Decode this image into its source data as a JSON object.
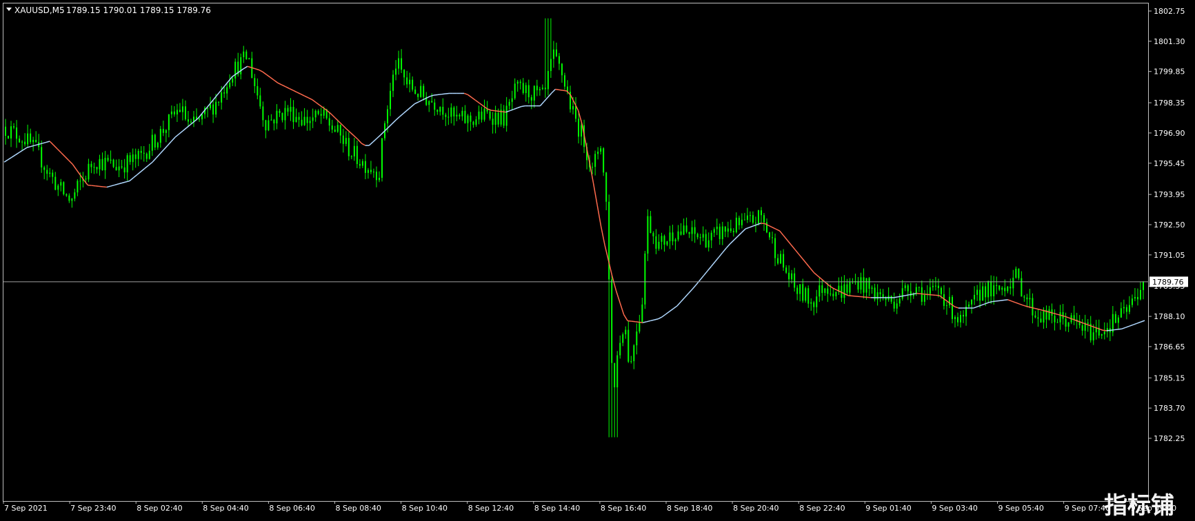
{
  "header": {
    "symbol_label": "XAUUSD,M5",
    "ohlc_label": "1789.15 1790.01 1789.15 1789.76"
  },
  "watermark": {
    "text": "指标铺"
  },
  "colors": {
    "background": "#000000",
    "frame": "#c0c0c0",
    "candle": "#00ff00",
    "ma_rising": "#b0d8ff",
    "ma_falling": "#ff6a4d",
    "price_line": "#a0a0a0",
    "price_tag_bg": "#ffffff",
    "price_tag_text": "#000000"
  },
  "chart_data": {
    "type": "candlestick",
    "symbol": "XAUUSD",
    "timeframe": "M5",
    "last_price": 1789.76,
    "current_price_label": "1789.76",
    "ylim": [
      1782.0,
      1803.0
    ],
    "y_ticks": [
      1802.75,
      1801.3,
      1799.85,
      1798.35,
      1796.9,
      1795.45,
      1793.95,
      1792.5,
      1791.05,
      1789.55,
      1788.1,
      1786.65,
      1785.15,
      1783.7,
      1782.25
    ],
    "y_tick_labels": [
      "1802.75",
      "1801.30",
      "1799.85",
      "1798.35",
      "1796.90",
      "1795.45",
      "1793.95",
      "1792.50",
      "1791.05",
      "1789.55",
      "1788.10",
      "1786.65",
      "1785.15",
      "1783.70",
      "1782.25"
    ],
    "x_labels": [
      "7 Sep 2021",
      "7 Sep 23:40",
      "8 Sep 02:40",
      "8 Sep 04:40",
      "8 Sep 06:40",
      "8 Sep 08:40",
      "8 Sep 10:40",
      "8 Sep 12:40",
      "8 Sep 14:40",
      "8 Sep 16:40",
      "8 Sep 18:40",
      "8 Sep 20:40",
      "8 Sep 22:40",
      "9 Sep 01:40",
      "9 Sep 03:40",
      "9 Sep 05:40",
      "9 Sep 07:40",
      "9 Sep 09:40"
    ],
    "price_path": [
      [
        0,
        1797.2
      ],
      [
        0.02,
        1796.6
      ],
      [
        0.03,
        1796.0
      ],
      [
        0.04,
        1795.0
      ],
      [
        0.05,
        1794.2
      ],
      [
        0.06,
        1793.6
      ],
      [
        0.065,
        1794.2
      ],
      [
        0.08,
        1795.6
      ],
      [
        0.1,
        1795.3
      ],
      [
        0.12,
        1795.7
      ],
      [
        0.14,
        1797.0
      ],
      [
        0.155,
        1798.1
      ],
      [
        0.165,
        1797.2
      ],
      [
        0.175,
        1797.6
      ],
      [
        0.19,
        1798.6
      ],
      [
        0.2,
        1799.8
      ],
      [
        0.215,
        1800.6
      ],
      [
        0.22,
        1799.4
      ],
      [
        0.23,
        1797.4
      ],
      [
        0.25,
        1798.0
      ],
      [
        0.265,
        1797.5
      ],
      [
        0.28,
        1797.7
      ],
      [
        0.295,
        1796.8
      ],
      [
        0.305,
        1796.0
      ],
      [
        0.315,
        1795.5
      ],
      [
        0.33,
        1795.0
      ],
      [
        0.335,
        1797.5
      ],
      [
        0.345,
        1800.3
      ],
      [
        0.355,
        1799.2
      ],
      [
        0.37,
        1798.6
      ],
      [
        0.385,
        1798.2
      ],
      [
        0.395,
        1797.6
      ],
      [
        0.41,
        1797.5
      ],
      [
        0.425,
        1797.8
      ],
      [
        0.44,
        1797.6
      ],
      [
        0.45,
        1799.0
      ],
      [
        0.465,
        1798.8
      ],
      [
        0.475,
        1798.6
      ],
      [
        0.482,
        1800.6
      ],
      [
        0.49,
        1799.8
      ],
      [
        0.5,
        1797.8
      ],
      [
        0.51,
        1796.5
      ],
      [
        0.517,
        1795.0
      ],
      [
        0.524,
        1796.6
      ],
      [
        0.53,
        1793.0
      ],
      [
        0.533,
        1787.5
      ],
      [
        0.535,
        1784.0
      ],
      [
        0.538,
        1786.0
      ],
      [
        0.545,
        1788.0
      ],
      [
        0.55,
        1785.5
      ],
      [
        0.555,
        1787.5
      ],
      [
        0.56,
        1788.4
      ],
      [
        0.565,
        1792.8
      ],
      [
        0.575,
        1791.5
      ],
      [
        0.59,
        1792.2
      ],
      [
        0.605,
        1792.0
      ],
      [
        0.62,
        1791.8
      ],
      [
        0.635,
        1792.3
      ],
      [
        0.65,
        1792.5
      ],
      [
        0.665,
        1792.9
      ],
      [
        0.675,
        1791.6
      ],
      [
        0.685,
        1790.4
      ],
      [
        0.695,
        1789.4
      ],
      [
        0.71,
        1788.8
      ],
      [
        0.72,
        1789.6
      ],
      [
        0.735,
        1789.3
      ],
      [
        0.75,
        1789.8
      ],
      [
        0.765,
        1789.2
      ],
      [
        0.78,
        1788.8
      ],
      [
        0.79,
        1789.3
      ],
      [
        0.8,
        1789.6
      ],
      [
        0.81,
        1789.0
      ],
      [
        0.82,
        1789.5
      ],
      [
        0.83,
        1788.6
      ],
      [
        0.84,
        1787.8
      ],
      [
        0.85,
        1788.6
      ],
      [
        0.86,
        1789.5
      ],
      [
        0.87,
        1789.2
      ],
      [
        0.88,
        1789.7
      ],
      [
        0.888,
        1790.0
      ],
      [
        0.895,
        1789.3
      ],
      [
        0.905,
        1788.2
      ],
      [
        0.92,
        1788.0
      ],
      [
        0.935,
        1787.9
      ],
      [
        0.945,
        1787.6
      ],
      [
        0.955,
        1787.3
      ],
      [
        0.965,
        1787.5
      ],
      [
        0.975,
        1787.9
      ],
      [
        0.985,
        1788.3
      ],
      [
        0.992,
        1788.9
      ],
      [
        1.0,
        1789.76
      ]
    ],
    "moving_average": [
      [
        0,
        1795.5
      ],
      [
        0.02,
        1796.2
      ],
      [
        0.04,
        1796.5
      ],
      [
        0.06,
        1795.4
      ],
      [
        0.073,
        1794.4
      ],
      [
        0.09,
        1794.3
      ],
      [
        0.11,
        1794.6
      ],
      [
        0.13,
        1795.5
      ],
      [
        0.15,
        1796.7
      ],
      [
        0.17,
        1797.6
      ],
      [
        0.185,
        1798.6
      ],
      [
        0.2,
        1799.6
      ],
      [
        0.213,
        1800.1
      ],
      [
        0.225,
        1799.9
      ],
      [
        0.24,
        1799.3
      ],
      [
        0.255,
        1798.9
      ],
      [
        0.27,
        1798.5
      ],
      [
        0.285,
        1797.9
      ],
      [
        0.3,
        1797.1
      ],
      [
        0.31,
        1796.6
      ],
      [
        0.315,
        1796.3
      ],
      [
        0.32,
        1796.3
      ],
      [
        0.33,
        1796.8
      ],
      [
        0.345,
        1797.6
      ],
      [
        0.36,
        1798.3
      ],
      [
        0.375,
        1798.7
      ],
      [
        0.39,
        1798.8
      ],
      [
        0.405,
        1798.8
      ],
      [
        0.415,
        1798.4
      ],
      [
        0.425,
        1798.0
      ],
      [
        0.44,
        1797.9
      ],
      [
        0.455,
        1798.2
      ],
      [
        0.47,
        1798.2
      ],
      [
        0.483,
        1799.0
      ],
      [
        0.495,
        1798.9
      ],
      [
        0.505,
        1797.8
      ],
      [
        0.515,
        1795.0
      ],
      [
        0.525,
        1791.9
      ],
      [
        0.535,
        1789.6
      ],
      [
        0.545,
        1787.9
      ],
      [
        0.56,
        1787.8
      ],
      [
        0.575,
        1788.0
      ],
      [
        0.59,
        1788.6
      ],
      [
        0.605,
        1789.5
      ],
      [
        0.62,
        1790.5
      ],
      [
        0.635,
        1791.5
      ],
      [
        0.65,
        1792.3
      ],
      [
        0.665,
        1792.6
      ],
      [
        0.68,
        1792.2
      ],
      [
        0.695,
        1791.2
      ],
      [
        0.71,
        1790.2
      ],
      [
        0.725,
        1789.5
      ],
      [
        0.74,
        1789.1
      ],
      [
        0.76,
        1789.0
      ],
      [
        0.78,
        1789.0
      ],
      [
        0.8,
        1789.2
      ],
      [
        0.82,
        1789.1
      ],
      [
        0.835,
        1788.5
      ],
      [
        0.85,
        1788.5
      ],
      [
        0.865,
        1788.8
      ],
      [
        0.88,
        1788.9
      ],
      [
        0.895,
        1788.6
      ],
      [
        0.91,
        1788.4
      ],
      [
        0.93,
        1788.1
      ],
      [
        0.95,
        1787.7
      ],
      [
        0.965,
        1787.4
      ],
      [
        0.98,
        1787.5
      ],
      [
        1.0,
        1787.9
      ]
    ]
  }
}
